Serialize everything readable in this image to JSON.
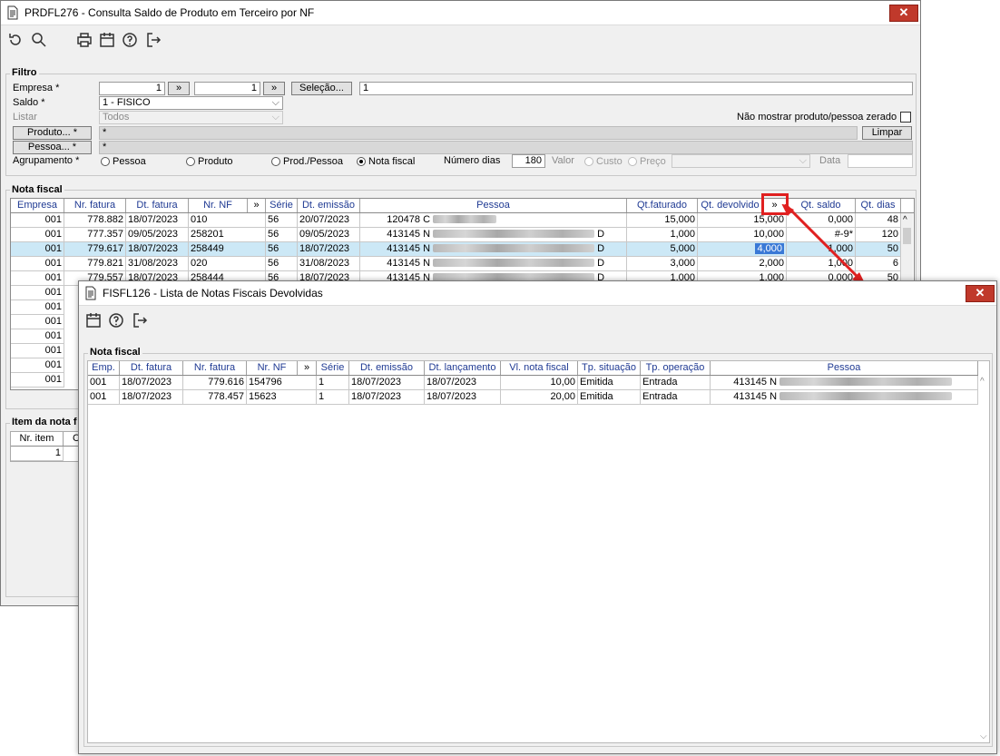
{
  "main": {
    "title": "PRDFL276 - Consulta Saldo de Produto em Terceiro por NF",
    "filter": {
      "group_label": "Filtro",
      "empresa_label": "Empresa *",
      "empresa_from": "1",
      "empresa_to": "1",
      "range_button": "»",
      "selecao_button": "Seleção...",
      "selecao_value": "1",
      "saldo_label": "Saldo *",
      "saldo_value": "1 - FISICO",
      "listar_label": "Listar",
      "listar_value": "Todos",
      "nao_mostrar_label": "Não mostrar produto/pessoa zerado",
      "produto_button": "Produto... *",
      "produto_value": "*",
      "limpar_button": "Limpar",
      "pessoa_button": "Pessoa... *",
      "pessoa_value": "*",
      "agrupamento_label": "Agrupamento *",
      "agrupamento_options": [
        "Pessoa",
        "Produto",
        "Prod./Pessoa",
        "Nota fiscal"
      ],
      "numero_dias_label": "Número dias",
      "numero_dias_value": "180",
      "valor_label": "Valor",
      "valor_options": [
        "Custo",
        "Preço"
      ],
      "data_label": "Data"
    },
    "nota_fiscal": {
      "group_label": "Nota fiscal",
      "columns": [
        "Empresa",
        "Nr. fatura",
        "Dt. fatura",
        "Nr. NF",
        "»",
        "Série",
        "Dt. emissão",
        "Pessoa",
        "Qt.faturado",
        "Qt. devolvido",
        "»",
        "Qt. saldo",
        "Qt. dias"
      ],
      "rows": [
        {
          "empresa": "001",
          "nr_fatura": "778.882",
          "dt_fatura": "18/07/2023",
          "nr_nf": "010",
          "serie": "56",
          "dt_emissao": "20/07/2023",
          "pessoa_cod": "120478",
          "pessoa_nome": "C",
          "pessoa_tail": "",
          "qt_faturado": "15,000",
          "qt_devolvido": "15,000",
          "qt_saldo": "0,000",
          "qt_dias": "48"
        },
        {
          "empresa": "001",
          "nr_fatura": "777.357",
          "dt_fatura": "09/05/2023",
          "nr_nf": "258201",
          "serie": "56",
          "dt_emissao": "09/05/2023",
          "pessoa_cod": "413145",
          "pessoa_nome": "N",
          "pessoa_tail": "D",
          "qt_faturado": "1,000",
          "qt_devolvido": "10,000",
          "qt_saldo": "#-9*",
          "qt_dias": "120"
        },
        {
          "empresa": "001",
          "nr_fatura": "779.617",
          "dt_fatura": "18/07/2023",
          "nr_nf": "258449",
          "serie": "56",
          "dt_emissao": "18/07/2023",
          "pessoa_cod": "413145",
          "pessoa_nome": "N",
          "pessoa_tail": "D",
          "qt_faturado": "5,000",
          "qt_devolvido": "4,000",
          "qt_saldo": "1,000",
          "qt_dias": "50"
        },
        {
          "empresa": "001",
          "nr_fatura": "779.821",
          "dt_fatura": "31/08/2023",
          "nr_nf": "020",
          "serie": "56",
          "dt_emissao": "31/08/2023",
          "pessoa_cod": "413145",
          "pessoa_nome": "N",
          "pessoa_tail": "D",
          "qt_faturado": "3,000",
          "qt_devolvido": "2,000",
          "qt_saldo": "1,000",
          "qt_dias": "6"
        },
        {
          "empresa": "001",
          "nr_fatura": "779.557",
          "dt_fatura": "18/07/2023",
          "nr_nf": "258444",
          "serie": "56",
          "dt_emissao": "18/07/2023",
          "pessoa_cod": "413145",
          "pessoa_nome": "N",
          "pessoa_tail": "D",
          "qt_faturado": "1,000",
          "qt_devolvido": "1,000",
          "qt_saldo": "0,000",
          "qt_dias": "50"
        }
      ],
      "extra_rows": [
        "001",
        "001",
        "001",
        "001",
        "001",
        "001",
        "001"
      ]
    },
    "item": {
      "group_label": "Item da nota f",
      "columns": [
        "Nr. item",
        "C"
      ],
      "row_value": "1"
    }
  },
  "dialog": {
    "title": "FISFL126 - Lista de Notas Fiscais Devolvidas",
    "group_label": "Nota fiscal",
    "columns": [
      "Emp.",
      "Dt. fatura",
      "Nr. fatura",
      "Nr. NF",
      "»",
      "Série",
      "Dt. emissão",
      "Dt. lançamento",
      "Vl. nota fiscal",
      "Tp. situação",
      "Tp. operação",
      "Pessoa"
    ],
    "rows": [
      {
        "emp": "001",
        "dt_fatura": "18/07/2023",
        "nr_fatura": "779.616",
        "nr_nf": "154796",
        "serie": "1",
        "dt_emissao": "18/07/2023",
        "dt_lancamento": "18/07/2023",
        "vl_nota": "10,00",
        "tp_situacao": "Emitida",
        "tp_operacao": "Entrada",
        "pessoa_cod": "413145",
        "pessoa_nome": "N"
      },
      {
        "emp": "001",
        "dt_fatura": "18/07/2023",
        "nr_fatura": "778.457",
        "nr_nf": "15623",
        "serie": "1",
        "dt_emissao": "18/07/2023",
        "dt_lancamento": "18/07/2023",
        "vl_nota": "20,00",
        "tp_situacao": "Emitida",
        "tp_operacao": "Entrada",
        "pessoa_cod": "413145",
        "pessoa_nome": "N"
      }
    ]
  },
  "icons": {
    "main_toolbar": [
      "refresh-icon",
      "search-icon",
      "print-icon",
      "calendar-icon",
      "help-icon",
      "exit-icon"
    ],
    "dialog_toolbar": [
      "calendar-icon",
      "help-icon",
      "exit-icon"
    ]
  },
  "colors": {
    "highlight_arrow": "#e02020",
    "selected_row": "#cce8f6",
    "header_text": "#1f3a93",
    "close_button": "#c0392b"
  }
}
